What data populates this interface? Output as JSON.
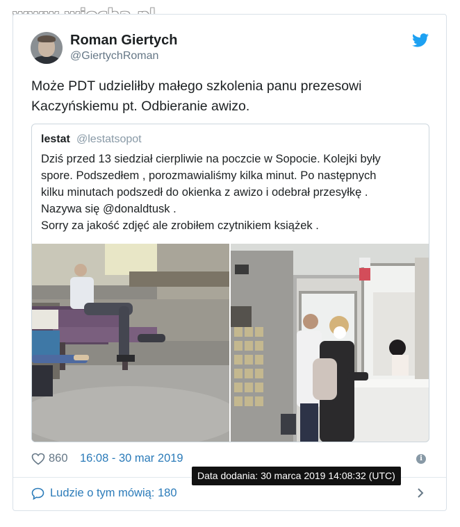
{
  "watermark": "www.wiocha.pl",
  "tweet": {
    "display_name": "Roman Giertych",
    "handle": "@GiertychRoman",
    "text": "Może PDT udzieliłby małego szkolenia panu prezesowi Kaczyńskiemu pt. Odbieranie awizo.",
    "likes": "860",
    "timestamp": "16:08 - 30 mar 2019",
    "people_talking": "Ludzie o tym mówią: 180",
    "tooltip": "Data dodania: 30 marca 2019 14:08:32 (UTC)"
  },
  "quoted": {
    "display_name": "lestat",
    "handle": "@lestatsopot",
    "lines": [
      "Dziś przed 13 siedział cierpliwie na poczcie w Sopocie. Kolejki były",
      "spore. Podszedłem , porozmawialiśmy kilka minut. Po następnych",
      "kilku minutach podszedł do okienka z awizo i odebrał przesyłkę .",
      "Nazywa się @donaldtusk .",
      "Sorry za jakość zdjęć ale zrobiłem czytnikiem książek ."
    ]
  },
  "icons": {
    "brand": "twitter-bird-icon",
    "like": "heart-icon",
    "info": "info-icon",
    "reply": "chat-bubble-icon",
    "more": "chevron-right-icon"
  },
  "colors": {
    "twitter_blue": "#1da1f2",
    "link_blue": "#2b7bb9",
    "gray_text": "#657786",
    "border": "#ccd6dd"
  }
}
